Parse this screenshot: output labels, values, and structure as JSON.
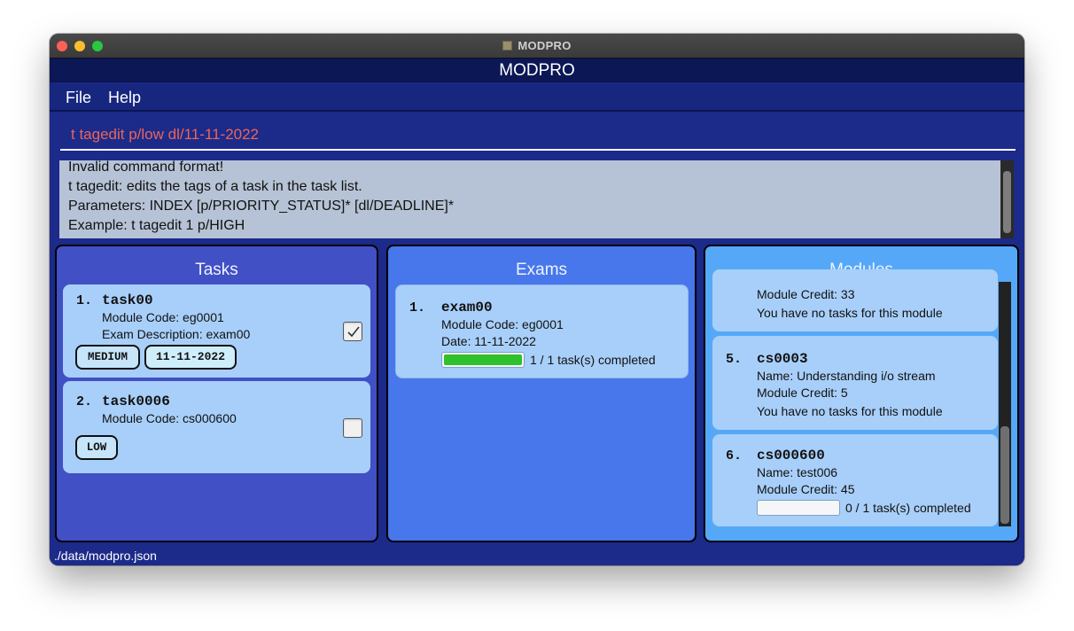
{
  "window": {
    "title": "MODPRO",
    "app_icon": "app-icon"
  },
  "header": {
    "title": "MODPRO"
  },
  "menu": {
    "items": [
      {
        "label": "File"
      },
      {
        "label": "Help"
      }
    ]
  },
  "command": {
    "value": "t tagedit p/low dl/11-11-2022",
    "color": "#e8665a"
  },
  "result": {
    "lines": [
      "Invalid command format!",
      "t tagedit: edits the tags of a task in the task list.",
      "Parameters: INDEX [p/PRIORITY_STATUS]* [dl/DEADLINE]*",
      "Example: t tagedit 1 p/HIGH"
    ]
  },
  "tasks": {
    "title": "Tasks",
    "items": [
      {
        "index": "1.",
        "name": "task00",
        "module": "Module Code: eg0001",
        "exam": "Exam Description: exam00",
        "tags": [
          "MEDIUM",
          "11-11-2022"
        ],
        "checked": true
      },
      {
        "index": "2.",
        "name": "task0006",
        "module": "Module Code: cs000600",
        "tags": [
          "LOW"
        ],
        "checked": false
      }
    ]
  },
  "exams": {
    "title": "Exams",
    "items": [
      {
        "index": "1.",
        "name": "exam00",
        "module": "Module Code: eg0001",
        "date": "Date: 11-11-2022",
        "progress_text": "1 / 1 task(s) completed",
        "progress": 1.0
      }
    ]
  },
  "modules": {
    "title": "Modules",
    "items": [
      {
        "credit": "Module Credit: 33",
        "tasks_note": "You have no tasks for this module"
      },
      {
        "index": "5.",
        "code": "cs0003",
        "name": "Name: Understanding i/o stream",
        "credit": "Module Credit: 5",
        "tasks_note": "You have no tasks for this module"
      },
      {
        "index": "6.",
        "code": "cs000600",
        "name": "Name: test006",
        "credit": "Module Credit: 45",
        "progress_text": "0 / 1 task(s) completed",
        "progress": 0.0
      }
    ]
  },
  "status": {
    "path": "./data/modpro.json"
  },
  "colors": {
    "accent": "#1c2a8a",
    "progress_fill": "#2ec12b",
    "tasks_panel": "#4150c4",
    "exams_panel": "#4777ea",
    "modules_panel": "#55a8f7",
    "card": "#a8cff9"
  }
}
